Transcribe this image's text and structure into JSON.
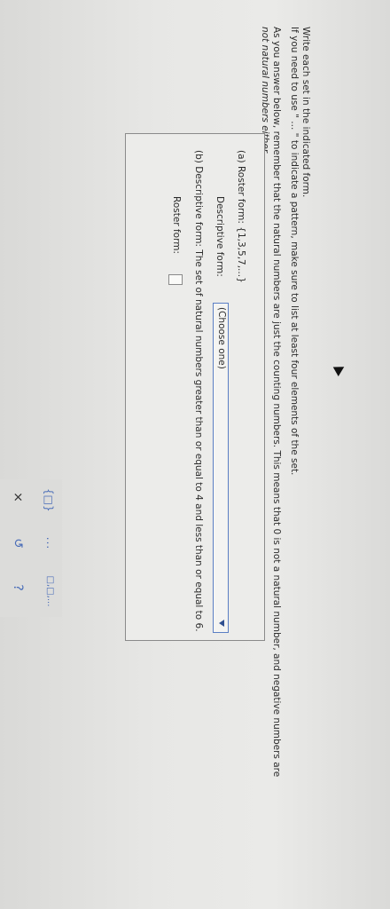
{
  "instructions": {
    "line1": "Write each set in the indicated form.",
    "line2": "If you need to use \" ... \" to indicate a pattern, make sure to list at least four elements of the set.",
    "line3": "As you answer below, remember that the natural numbers are just the counting numbers. This means that 0 is not a natural number, and negative numbers are",
    "line4": "not natural numbers either."
  },
  "part_a": {
    "label": "(a)",
    "roster_label": "Roster form:",
    "roster_value": "{1,3,5,7,...}",
    "descriptive_label": "Descriptive form:",
    "dropdown_value": "(Choose one)"
  },
  "part_b": {
    "label": "(b)",
    "descriptive_text": "Descriptive form: The set of natural numbers greater than or equal to 4 and less than or equal to 6.",
    "roster_label": "Roster form:",
    "roster_value": ""
  },
  "toolbox": {
    "set_braces_symbol": "{□}",
    "ellipsis_symbol": "...",
    "sets_symbol": "□,□,...",
    "close_symbol": "×",
    "undo_symbol": "↺",
    "help_symbol": "?"
  },
  "colors": {
    "accent": "#4a6db8",
    "dropdown_border": "#5b7fc4",
    "background": "#e7e7e5"
  }
}
